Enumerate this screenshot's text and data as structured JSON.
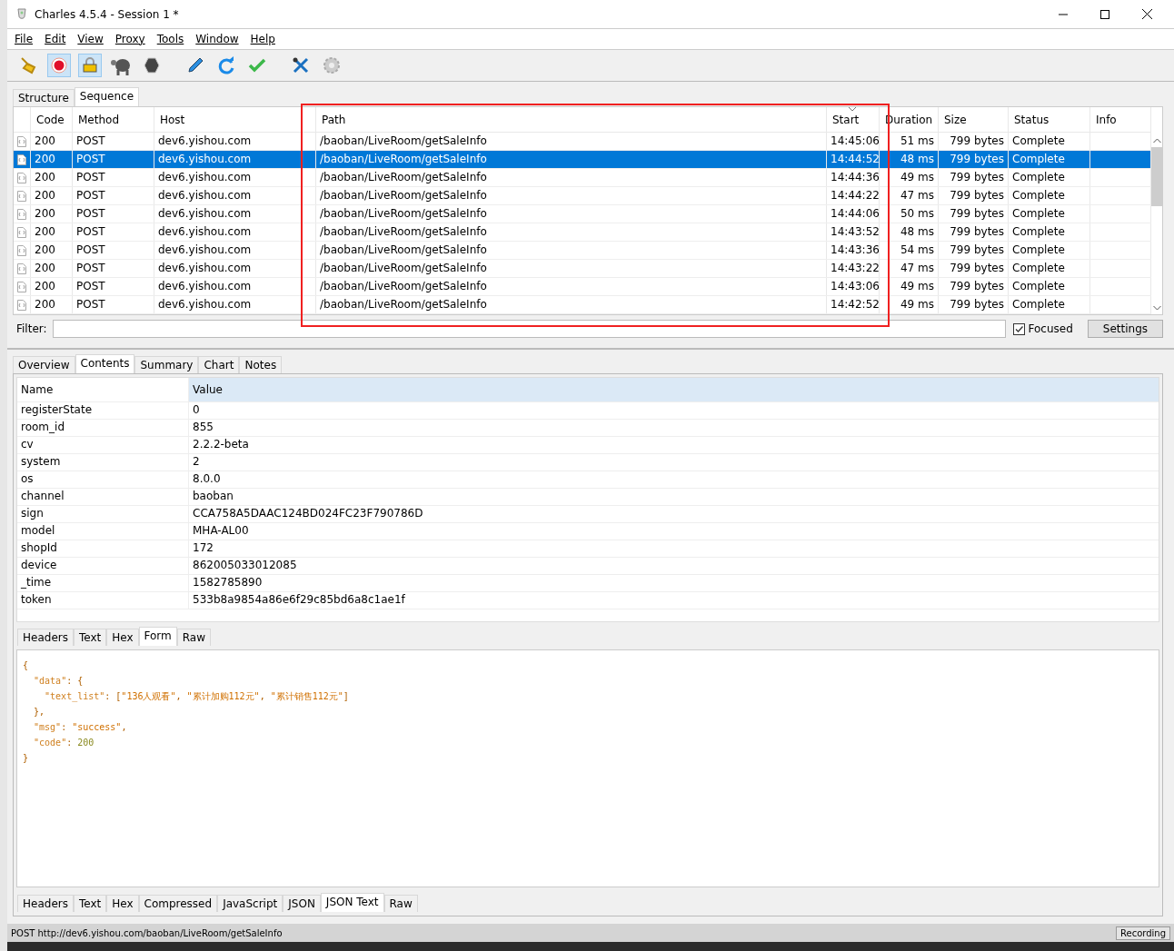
{
  "window": {
    "title": "Charles 4.5.4 - Session 1 *"
  },
  "menu": [
    "File",
    "Edit",
    "View",
    "Proxy",
    "Tools",
    "Window",
    "Help"
  ],
  "toolbar": [
    {
      "kind": "broom",
      "on": false
    },
    {
      "kind": "record",
      "on": true
    },
    {
      "kind": "lock",
      "on": true
    },
    {
      "kind": "turtle",
      "on": false
    },
    {
      "kind": "stop",
      "on": false
    },
    {
      "kind": "pen",
      "on": false
    },
    {
      "kind": "refresh",
      "on": false
    },
    {
      "kind": "check",
      "on": false
    },
    {
      "kind": "tools",
      "on": false
    },
    {
      "kind": "gear",
      "on": false
    }
  ],
  "view_tabs": [
    {
      "label": "Structure",
      "selected": false
    },
    {
      "label": "Sequence",
      "selected": true
    }
  ],
  "table": {
    "columns": [
      {
        "label": "Code",
        "sorted": false
      },
      {
        "label": "Method",
        "sorted": false
      },
      {
        "label": "Host",
        "sorted": false
      },
      {
        "label": "Path",
        "sorted": false
      },
      {
        "label": "Start",
        "sorted": true
      },
      {
        "label": "Duration",
        "sorted": false
      },
      {
        "label": "Size",
        "sorted": false
      },
      {
        "label": "Status",
        "sorted": false
      },
      {
        "label": "Info",
        "sorted": false
      }
    ],
    "rows": [
      {
        "code": "200",
        "method": "POST",
        "host": "dev6.yishou.com",
        "path": "/baoban/LiveRoom/getSaleInfo",
        "start": "14:45:06",
        "duration": "51 ms",
        "size": "799 bytes",
        "status": "Complete",
        "selected": false
      },
      {
        "code": "200",
        "method": "POST",
        "host": "dev6.yishou.com",
        "path": "/baoban/LiveRoom/getSaleInfo",
        "start": "14:44:52",
        "duration": "48 ms",
        "size": "799 bytes",
        "status": "Complete",
        "selected": true
      },
      {
        "code": "200",
        "method": "POST",
        "host": "dev6.yishou.com",
        "path": "/baoban/LiveRoom/getSaleInfo",
        "start": "14:44:36",
        "duration": "49 ms",
        "size": "799 bytes",
        "status": "Complete",
        "selected": false
      },
      {
        "code": "200",
        "method": "POST",
        "host": "dev6.yishou.com",
        "path": "/baoban/LiveRoom/getSaleInfo",
        "start": "14:44:22",
        "duration": "47 ms",
        "size": "799 bytes",
        "status": "Complete",
        "selected": false
      },
      {
        "code": "200",
        "method": "POST",
        "host": "dev6.yishou.com",
        "path": "/baoban/LiveRoom/getSaleInfo",
        "start": "14:44:06",
        "duration": "50 ms",
        "size": "799 bytes",
        "status": "Complete",
        "selected": false
      },
      {
        "code": "200",
        "method": "POST",
        "host": "dev6.yishou.com",
        "path": "/baoban/LiveRoom/getSaleInfo",
        "start": "14:43:52",
        "duration": "48 ms",
        "size": "799 bytes",
        "status": "Complete",
        "selected": false
      },
      {
        "code": "200",
        "method": "POST",
        "host": "dev6.yishou.com",
        "path": "/baoban/LiveRoom/getSaleInfo",
        "start": "14:43:36",
        "duration": "54 ms",
        "size": "799 bytes",
        "status": "Complete",
        "selected": false
      },
      {
        "code": "200",
        "method": "POST",
        "host": "dev6.yishou.com",
        "path": "/baoban/LiveRoom/getSaleInfo",
        "start": "14:43:22",
        "duration": "47 ms",
        "size": "799 bytes",
        "status": "Complete",
        "selected": false
      },
      {
        "code": "200",
        "method": "POST",
        "host": "dev6.yishou.com",
        "path": "/baoban/LiveRoom/getSaleInfo",
        "start": "14:43:06",
        "duration": "49 ms",
        "size": "799 bytes",
        "status": "Complete",
        "selected": false
      },
      {
        "code": "200",
        "method": "POST",
        "host": "dev6.yishou.com",
        "path": "/baoban/LiveRoom/getSaleInfo",
        "start": "14:42:52",
        "duration": "49 ms",
        "size": "799 bytes",
        "status": "Complete",
        "selected": false
      }
    ]
  },
  "filter": {
    "label": "Filter:",
    "focused": {
      "label": "Focused",
      "checked": true
    },
    "settings": "Settings"
  },
  "detail_tabs": [
    {
      "label": "Overview",
      "selected": false
    },
    {
      "label": "Contents",
      "selected": true
    },
    {
      "label": "Summary",
      "selected": false
    },
    {
      "label": "Chart",
      "selected": false
    },
    {
      "label": "Notes",
      "selected": false
    }
  ],
  "form": {
    "columns": [
      "Name",
      "Value"
    ],
    "rows": [
      {
        "name": "registerState",
        "value": "0"
      },
      {
        "name": "room_id",
        "value": "855"
      },
      {
        "name": "cv",
        "value": "2.2.2-beta"
      },
      {
        "name": "system",
        "value": "2"
      },
      {
        "name": "os",
        "value": "8.0.0"
      },
      {
        "name": "channel",
        "value": "baoban"
      },
      {
        "name": "sign",
        "value": "CCA758A5DAAC124BD024FC23F790786D"
      },
      {
        "name": "model",
        "value": "MHA-AL00"
      },
      {
        "name": "shopId",
        "value": "172"
      },
      {
        "name": "device",
        "value": "862005033012085"
      },
      {
        "name": "_time",
        "value": "1582785890"
      },
      {
        "name": "token",
        "value": "533b8a9854a86e6f29c85bd6a8c1ae1f"
      }
    ]
  },
  "request_tabs": [
    {
      "label": "Headers",
      "selected": false
    },
    {
      "label": "Text",
      "selected": false
    },
    {
      "label": "Hex",
      "selected": false
    },
    {
      "label": "Form",
      "selected": true
    },
    {
      "label": "Raw",
      "selected": false
    }
  ],
  "json_tree": [
    {
      "tokens": [
        {
          "kind": "punct",
          "text": "{"
        }
      ],
      "children": [
        {
          "tokens": [
            {
              "kind": "key",
              "text": "\"data\""
            },
            {
              "kind": "punct",
              "text": ": {"
            }
          ],
          "children": [
            {
              "tokens": [
                {
                  "kind": "key",
                  "text": "\"text_list\""
                },
                {
                  "kind": "punct",
                  "text": ": ["
                },
                {
                  "kind": "string",
                  "text": "\"136人观看\""
                },
                {
                  "kind": "punct",
                  "text": ", "
                },
                {
                  "kind": "string",
                  "text": "\"累计加购112元\""
                },
                {
                  "kind": "punct",
                  "text": ", "
                },
                {
                  "kind": "string",
                  "text": "\"累计销售112元\""
                },
                {
                  "kind": "punct",
                  "text": "]"
                }
              ]
            }
          ]
        },
        {
          "tokens": [
            {
              "kind": "punct",
              "text": "},"
            }
          ]
        },
        {
          "tokens": [
            {
              "kind": "key",
              "text": "\"msg\""
            },
            {
              "kind": "punct",
              "text": ": "
            },
            {
              "kind": "string",
              "text": "\"success\""
            },
            {
              "kind": "punct",
              "text": ","
            }
          ]
        },
        {
          "tokens": [
            {
              "kind": "key",
              "text": "\"code\""
            },
            {
              "kind": "punct",
              "text": ": "
            },
            {
              "kind": "number",
              "text": "200"
            }
          ]
        }
      ]
    },
    {
      "tokens": [
        {
          "kind": "punct",
          "text": "}"
        }
      ]
    }
  ],
  "response_tabs": [
    {
      "label": "Headers",
      "selected": false
    },
    {
      "label": "Text",
      "selected": false
    },
    {
      "label": "Hex",
      "selected": false
    },
    {
      "label": "Compressed",
      "selected": false
    },
    {
      "label": "JavaScript",
      "selected": false
    },
    {
      "label": "JSON",
      "selected": false
    },
    {
      "label": "JSON Text",
      "selected": true
    },
    {
      "label": "Raw",
      "selected": false
    }
  ],
  "status_bar": {
    "text": "POST http://dev6.yishou.com/baoban/LiveRoom/getSaleInfo",
    "button": "Recording"
  }
}
